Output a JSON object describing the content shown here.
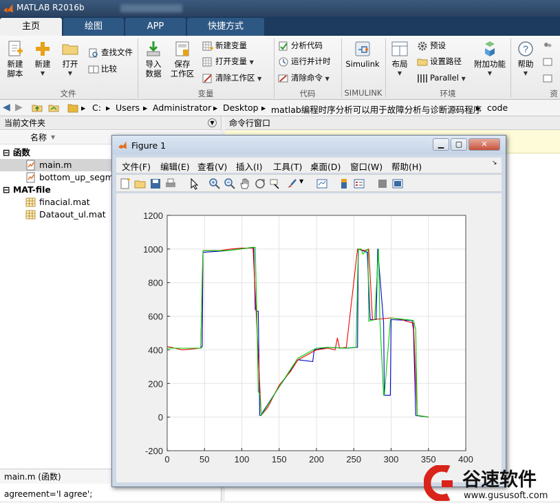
{
  "window": {
    "title": "MATLAB R2016b"
  },
  "tabs": [
    {
      "label": "主页"
    },
    {
      "label": "绘图"
    },
    {
      "label": "APP"
    },
    {
      "label": "快捷方式"
    }
  ],
  "ribbon": {
    "groups": {
      "file": "文件",
      "variable": "变量",
      "code": "代码",
      "simulink": "SIMULINK",
      "env": "环境",
      "resources": "资"
    },
    "new_script": [
      "新建",
      "脚本"
    ],
    "new": "新建",
    "open": "打开",
    "find_files": "查找文件",
    "compare": "比较",
    "import_data": [
      "导入",
      "数据"
    ],
    "save_workspace": [
      "保存",
      "工作区"
    ],
    "new_variable": "新建变量",
    "open_variable": "打开变量",
    "clear_workspace": "清除工作区",
    "analyze_code": "分析代码",
    "run_and_time": "运行并计时",
    "clear_commands": "清除命令",
    "simulink": "Simulink",
    "layout": "布局",
    "preferences": "预设",
    "set_path": "设置路径",
    "parallel": "Parallel",
    "addons": "附加功能",
    "help": "帮助"
  },
  "address": {
    "path": [
      "C:",
      "Users",
      "Administrator",
      "Desktop",
      "matlab编程时序分析可以用于故障分析与诊断源码程序",
      "code"
    ]
  },
  "current_folder": {
    "header": "当前文件夹",
    "column_name": "名称",
    "sections": [
      {
        "label": "函数",
        "items": [
          "main.m",
          "bottom_up_segme"
        ]
      },
      {
        "label": "MAT-file",
        "items": [
          "finacial.mat",
          "Dataout_ul.mat"
        ]
      }
    ],
    "detail": "main.m  (函数)",
    "code_preview": "agreement='I agree';"
  },
  "command_window": {
    "header": "命令行窗口"
  },
  "figure": {
    "title": "Figure 1",
    "menu": [
      "文件(F)",
      "编辑(E)",
      "查看(V)",
      "插入(I)",
      "工具(T)",
      "桌面(D)",
      "窗口(W)",
      "帮助(H)"
    ]
  },
  "chart_data": {
    "type": "line",
    "xlim": [
      0,
      400
    ],
    "ylim": [
      -200,
      1200
    ],
    "xticks": [
      0,
      50,
      100,
      150,
      200,
      250,
      300,
      350,
      400
    ],
    "yticks": [
      -200,
      0,
      200,
      400,
      600,
      800,
      1000,
      1200
    ],
    "grid": true,
    "series": [
      {
        "color": "#0000cc",
        "x": [
          0,
          20,
          45,
          47,
          48,
          80,
          115,
          116,
          118,
          120,
          122,
          124,
          126,
          128,
          150,
          175,
          177,
          195,
          197,
          215,
          240,
          255,
          256,
          262,
          268,
          272,
          273,
          280,
          282,
          290,
          291,
          299,
          300,
          325,
          328,
          330,
          333,
          340,
          350
        ],
        "y": [
          410,
          410,
          410,
          420,
          980,
          990,
          1010,
          1010,
          640,
          630,
          630,
          10,
          10,
          30,
          180,
          340,
          340,
          330,
          400,
          415,
          410,
          415,
          1000,
          990,
          980,
          580,
          580,
          580,
          1000,
          560,
          130,
          130,
          580,
          575,
          575,
          520,
          10,
          5,
          0
        ]
      },
      {
        "color": "#ee0000",
        "x": [
          0,
          20,
          45,
          48,
          55,
          70,
          85,
          100,
          115,
          126,
          135,
          150,
          165,
          175,
          200,
          215,
          225,
          228,
          231,
          240,
          255,
          265,
          270,
          275,
          300,
          315,
          320,
          330,
          335,
          350
        ],
        "y": [
          420,
          400,
          410,
          990,
          990,
          990,
          1000,
          1005,
          1005,
          10,
          60,
          190,
          270,
          340,
          400,
          410,
          400,
          470,
          410,
          415,
          1000,
          990,
          1000,
          580,
          590,
          580,
          570,
          560,
          10,
          0
        ]
      },
      {
        "color": "#00cc00",
        "x": [
          0,
          20,
          45,
          47,
          48,
          80,
          115,
          118,
          120,
          122,
          124,
          126,
          150,
          175,
          200,
          215,
          235,
          253,
          256,
          260,
          262,
          269,
          270,
          278,
          283,
          285,
          290,
          291,
          299,
          300,
          330,
          333,
          335,
          350
        ],
        "y": [
          410,
          410,
          410,
          850,
          990,
          990,
          1010,
          1010,
          640,
          150,
          140,
          10,
          180,
          350,
          410,
          415,
          410,
          415,
          1000,
          1000,
          970,
          1000,
          570,
          580,
          1000,
          580,
          130,
          130,
          575,
          590,
          575,
          520,
          10,
          0
        ]
      }
    ]
  }
}
